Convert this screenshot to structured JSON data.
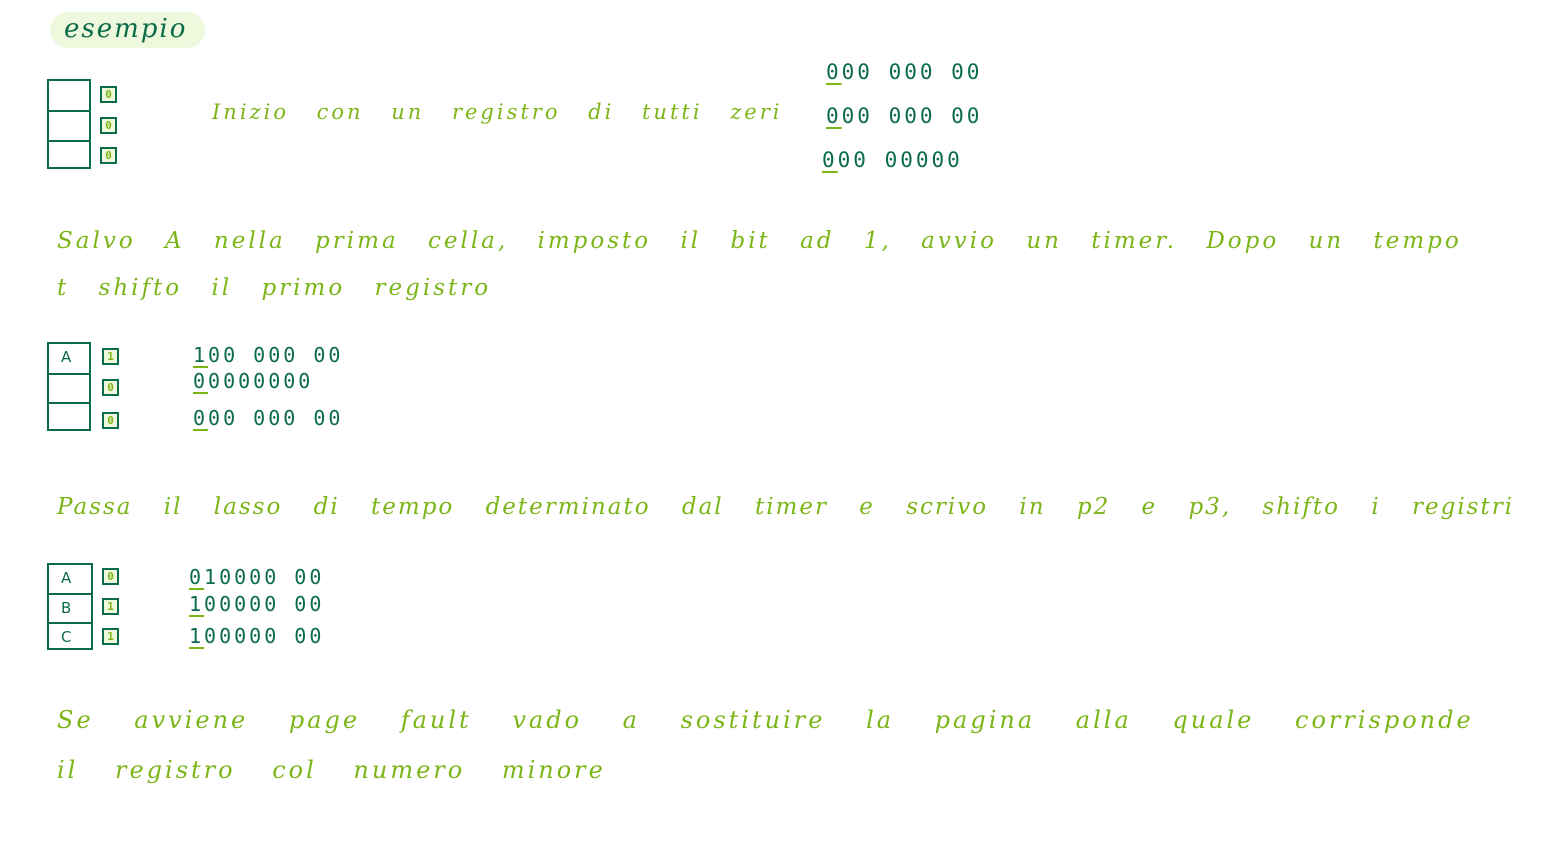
{
  "title": "esempio",
  "sections": [
    {
      "text_lines": [
        "Inizio con un registro di tutti zeri"
      ],
      "table": {
        "cells": [
          "",
          "",
          ""
        ],
        "bits": [
          "0",
          "0",
          "0"
        ]
      },
      "registers": [
        "000 000 00",
        "000 000 00",
        "000 00000"
      ]
    },
    {
      "text_lines": [
        "Salvo A nella prima cella, imposto il bit ad 1, avvio un timer. Dopo un tempo",
        "t shifto il primo registro"
      ],
      "table": {
        "cells": [
          "A",
          "",
          ""
        ],
        "bits": [
          "1",
          "0",
          "0"
        ]
      },
      "registers": [
        "100 000 00",
        "00000000",
        "000 000 00"
      ]
    },
    {
      "text_lines": [
        "Passa il lasso di tempo determinato dal timer e scrivo in p2 e p3, shifto i registri"
      ],
      "table": {
        "cells": [
          "A",
          "B",
          "C"
        ],
        "bits": [
          "0",
          "1",
          "1"
        ]
      },
      "registers": [
        "010000 00",
        "100000 00",
        "100000 00"
      ]
    },
    {
      "text_lines": [
        "Se avviene page fault vado a sostituire la pagina alla quale corrisponde",
        "il registro col numero minore"
      ]
    }
  ],
  "colors": {
    "ink_green": "#0b6b4a",
    "ink_lime": "#7cb518",
    "highlight": "#eef8dc"
  }
}
